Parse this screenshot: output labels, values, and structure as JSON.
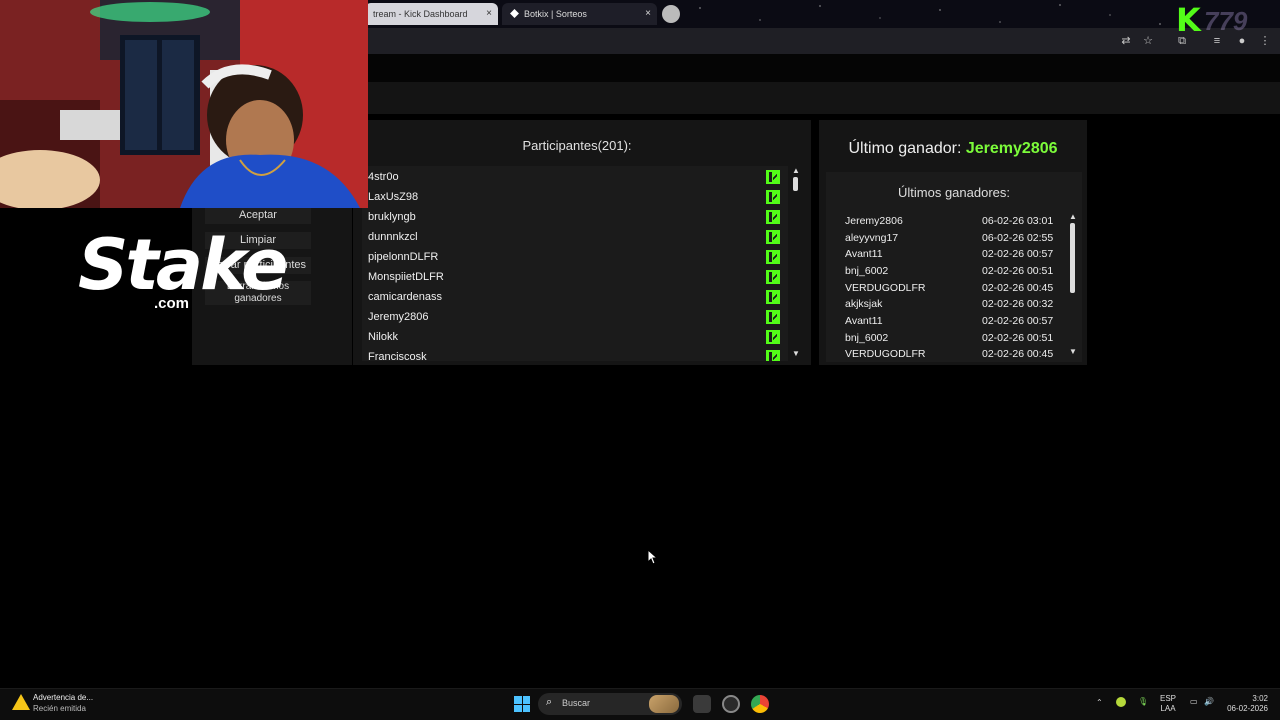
{
  "browser": {
    "tabs": [
      {
        "label": "tream - Kick Dashboard",
        "close": "×"
      },
      {
        "label": "Botkix | Sorteos",
        "close": "×"
      }
    ]
  },
  "overlay": {
    "brand_k": "K",
    "brand_num": "779"
  },
  "controls": {
    "buttons": [
      "Aceptar",
      "Limpiar",
      "Borrar participantes",
      "Borrar últimos ganadores"
    ]
  },
  "participants": {
    "title": "Participantes(201):",
    "names": [
      "4str0o",
      "LaxUsZ98",
      "bruklyngb",
      "dunnnkzcl",
      "pipelonnDLFR",
      "MonspiietDLFR",
      "camicardenass",
      "Jeremy2806",
      "Nilokk",
      "Franciscosk"
    ]
  },
  "winners": {
    "last_label": "Último ganador:",
    "last_name": "Jeremy2806",
    "subtitle": "Últimos ganadores:",
    "rows": [
      {
        "name": "Jeremy2806",
        "date": "06-02-26 03:01"
      },
      {
        "name": "aleyyvng17",
        "date": "06-02-26 02:55"
      },
      {
        "name": "Avant11",
        "date": "02-02-26 00:57"
      },
      {
        "name": "bnj_6002",
        "date": "02-02-26 00:51"
      },
      {
        "name": "VERDUGODLFR",
        "date": "02-02-26 00:45"
      },
      {
        "name": "akjksjak",
        "date": "02-02-26 00:32"
      },
      {
        "name": "Avant11",
        "date": "02-02-26 00:57"
      },
      {
        "name": "bnj_6002",
        "date": "02-02-26 00:51"
      },
      {
        "name": "VERDUGODLFR",
        "date": "02-02-26 00:45"
      }
    ]
  },
  "stake": {
    "word": "Stake",
    "suffix": ".com"
  },
  "taskbar": {
    "notification_title": "Advertencia de...",
    "notification_sub": "Recién emitida",
    "search_label": "Buscar",
    "lang_top": "ESP",
    "lang_bottom": "LAA",
    "time": "3:02",
    "date": "06-02-2026"
  },
  "colors": {
    "kick_green": "#53fc18",
    "winner_green": "#7cfc3a",
    "panel": "#151515"
  }
}
